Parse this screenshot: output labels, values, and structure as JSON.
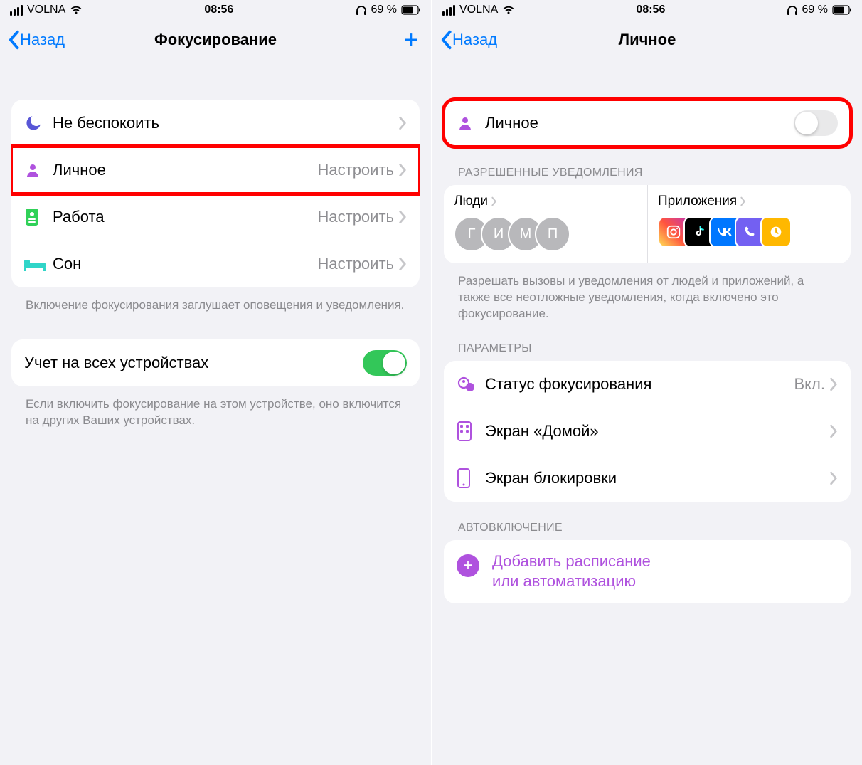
{
  "left": {
    "status": {
      "carrier": "VOLNA",
      "time": "08:56",
      "battery": "69 %"
    },
    "nav": {
      "back": "Назад",
      "title": "Фокусирование"
    },
    "focus_list": [
      {
        "label": "Не беспокоить",
        "detail": "",
        "icon": "moon",
        "color": "#5856d6"
      },
      {
        "label": "Личное",
        "detail": "Настроить",
        "icon": "person",
        "color": "#af52de",
        "highlight": true
      },
      {
        "label": "Работа",
        "detail": "Настроить",
        "icon": "badge",
        "color": "#30d158"
      },
      {
        "label": "Сон",
        "detail": "Настроить",
        "icon": "bed",
        "color": "#30d5c8"
      }
    ],
    "footer1": "Включение фокусирования заглушает оповещения и уведомления.",
    "share_row": {
      "label": "Учет на всех устройствах",
      "on": true
    },
    "footer2": "Если включить фокусирование на этом устройстве, оно включится на других Ваших устройствах."
  },
  "right": {
    "status": {
      "carrier": "VOLNA",
      "time": "08:56",
      "battery": "69 %"
    },
    "nav": {
      "back": "Назад",
      "title": "Личное"
    },
    "main_toggle": {
      "label": "Личное",
      "on": false
    },
    "allowed_header": "РАЗРЕШЕННЫЕ УВЕДОМЛЕНИЯ",
    "people": {
      "title": "Люди",
      "initials": [
        "Г",
        "И",
        "М",
        "П"
      ]
    },
    "apps": {
      "title": "Приложения"
    },
    "allowed_footer": "Разрешать вызовы и уведомления от людей и приложений, а также все неотложные уведомления, когда включено это фокусирование.",
    "params_header": "ПАРАМЕТРЫ",
    "params": [
      {
        "label": "Статус фокусирования",
        "detail": "Вкл.",
        "icon": "status"
      },
      {
        "label": "Экран «Домой»",
        "detail": "",
        "icon": "home"
      },
      {
        "label": "Экран блокировки",
        "detail": "",
        "icon": "lock"
      }
    ],
    "auto_header": "АВТОВКЛЮЧЕНИЕ",
    "add": {
      "line1": "Добавить расписание",
      "line2": "или автоматизацию"
    }
  }
}
